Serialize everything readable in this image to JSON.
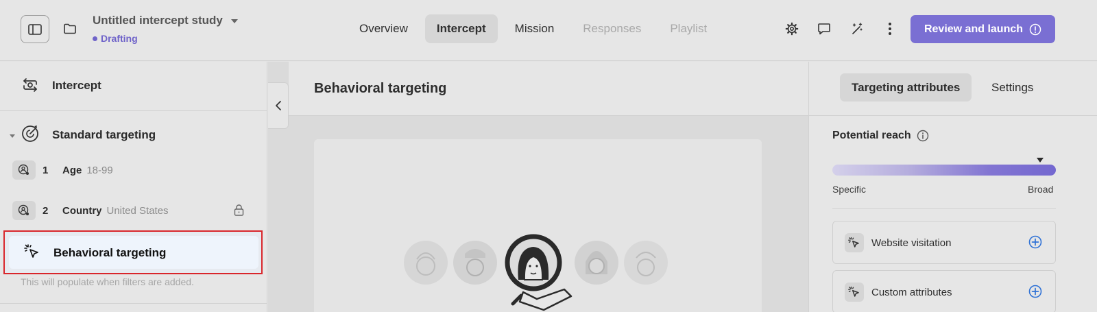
{
  "header": {
    "study_title": "Untitled intercept study",
    "status": "Drafting",
    "tabs": [
      {
        "label": "Overview",
        "state": "normal"
      },
      {
        "label": "Intercept",
        "state": "active"
      },
      {
        "label": "Mission",
        "state": "normal"
      },
      {
        "label": "Responses",
        "state": "disabled"
      },
      {
        "label": "Playlist",
        "state": "disabled"
      }
    ],
    "icons": [
      "sidebar-toggle-icon",
      "folder-icon",
      "gear-icon",
      "comment-icon",
      "magic-wand-icon",
      "more-vertical-icon"
    ],
    "launch_button": "Review and launch",
    "accent_color": "#7a6fd3"
  },
  "left_panel": {
    "header_label": "Intercept",
    "section_label": "Standard targeting",
    "rows": [
      {
        "num": "1",
        "name": "Age",
        "value": "18-99"
      },
      {
        "num": "2",
        "name": "Country",
        "value": "United States"
      }
    ],
    "behavioral_label": "Behavioral targeting",
    "behavioral_hint": "This will populate when filters are added."
  },
  "center": {
    "title": "Behavioral targeting"
  },
  "right_panel": {
    "tabs": [
      "Targeting attributes",
      "Settings"
    ],
    "reach_title": "Potential reach",
    "reach_min_label": "Specific",
    "reach_max_label": "Broad",
    "reach_level": 0.93,
    "attributes": [
      {
        "label": "Website visitation",
        "icon": "cursor-click-icon"
      },
      {
        "label": "Custom attributes",
        "icon": "cursor-click-icon"
      }
    ]
  }
}
